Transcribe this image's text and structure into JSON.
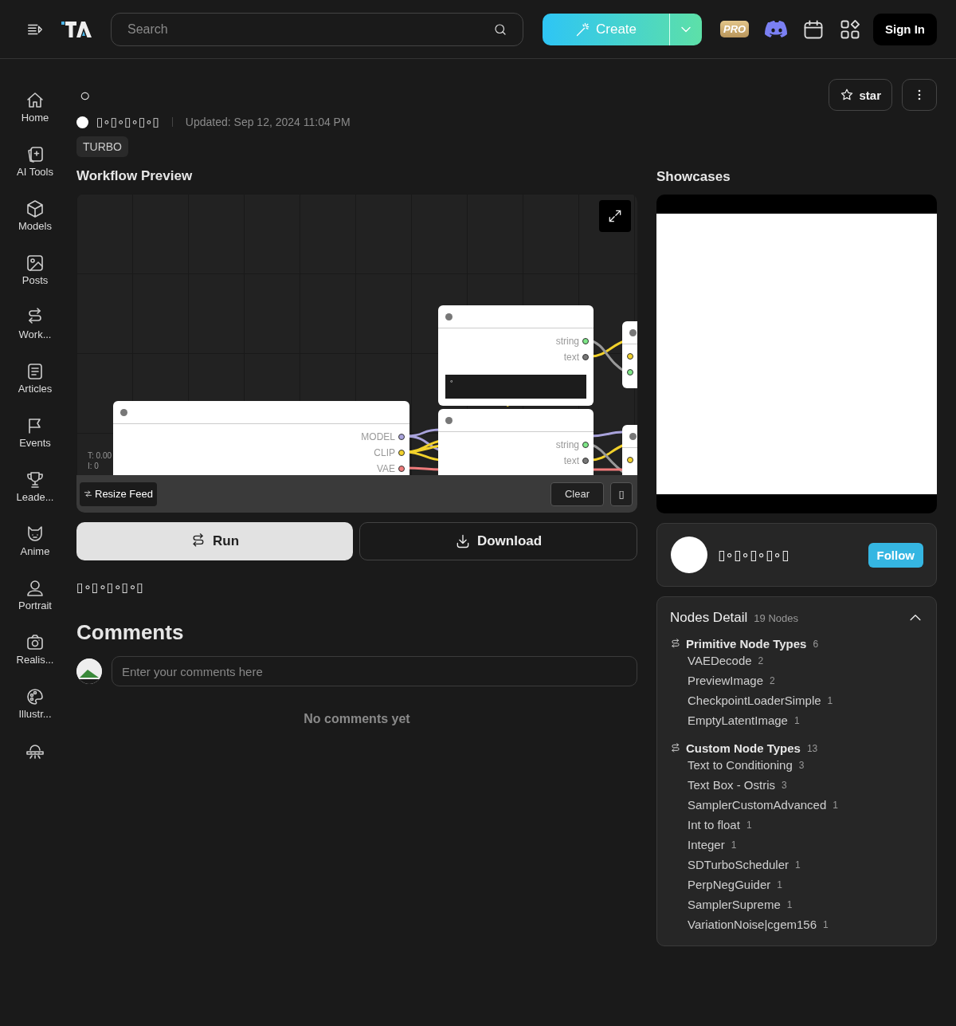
{
  "header": {
    "search": {
      "placeholder": "Search"
    },
    "create": "Create",
    "pro": "PRO",
    "sign_in": "Sign In"
  },
  "sidebar": {
    "items": [
      {
        "label": "Home"
      },
      {
        "label": "AI Tools"
      },
      {
        "label": "Models"
      },
      {
        "label": "Posts"
      },
      {
        "label": "Work..."
      },
      {
        "label": "Articles"
      },
      {
        "label": "Events"
      },
      {
        "label": "Leade..."
      },
      {
        "label": "Anime"
      },
      {
        "label": "Portrait"
      },
      {
        "label": "Realis..."
      },
      {
        "label": "Illustr..."
      }
    ]
  },
  "workflow": {
    "title": "○",
    "author": "▯∘▯∘▯∘▯∘▯",
    "updated": "Updated: Sep 12, 2024 11:04 PM",
    "tag": "TURBO",
    "star": "star",
    "preview": {
      "heading": "Workflow Preview",
      "nodes": [
        {
          "outputs": [
            {
              "label": "MODEL",
              "color": "#a9a3dc"
            },
            {
              "label": "CLIP",
              "color": "#f2d12b"
            },
            {
              "label": "VAE",
              "color": "#ef7b7b"
            }
          ]
        },
        {
          "outputs": [
            {
              "label": "string",
              "color": "#7ee787"
            },
            {
              "label": "text",
              "color": "#777777"
            }
          ],
          "widget": "∘"
        },
        {
          "outputs": [
            {
              "label": "string",
              "color": "#7ee787"
            },
            {
              "label": "text",
              "color": "#777777"
            }
          ]
        }
      ],
      "stats": [
        "T: 0.00",
        "I: 0"
      ],
      "toolbar": {
        "resize": "Resize Feed",
        "clear": "Clear",
        "extra": "▯"
      }
    },
    "run": "Run",
    "download": "Download",
    "description": "▯∘▯∘▯∘▯∘▯",
    "comments": {
      "heading": "Comments",
      "placeholder": "Enter your comments here",
      "empty": "No comments yet"
    }
  },
  "aside": {
    "showcases": "Showcases",
    "author": "▯∘▯∘▯∘▯∘▯",
    "follow": "Follow",
    "nodes_detail": {
      "title": "Nodes Detail",
      "count": "19 Nodes",
      "expanded": true,
      "groups": [
        {
          "name": "Primitive Node Types",
          "count": "6",
          "items": [
            {
              "name": "VAEDecode",
              "count": "2"
            },
            {
              "name": "PreviewImage",
              "count": "2"
            },
            {
              "name": "CheckpointLoaderSimple",
              "count": "1"
            },
            {
              "name": "EmptyLatentImage",
              "count": "1"
            }
          ]
        },
        {
          "name": "Custom Node Types",
          "count": "13",
          "items": [
            {
              "name": "Text to Conditioning",
              "count": "3"
            },
            {
              "name": "Text Box - Ostris",
              "count": "3"
            },
            {
              "name": "SamplerCustomAdvanced",
              "count": "1"
            },
            {
              "name": "Int to float",
              "count": "1"
            },
            {
              "name": "Integer",
              "count": "1"
            },
            {
              "name": "SDTurboScheduler",
              "count": "1"
            },
            {
              "name": "PerpNegGuider",
              "count": "1"
            },
            {
              "name": "SamplerSupreme",
              "count": "1"
            },
            {
              "name": "VariationNoise|cgem156",
              "count": "1"
            }
          ]
        }
      ]
    }
  }
}
